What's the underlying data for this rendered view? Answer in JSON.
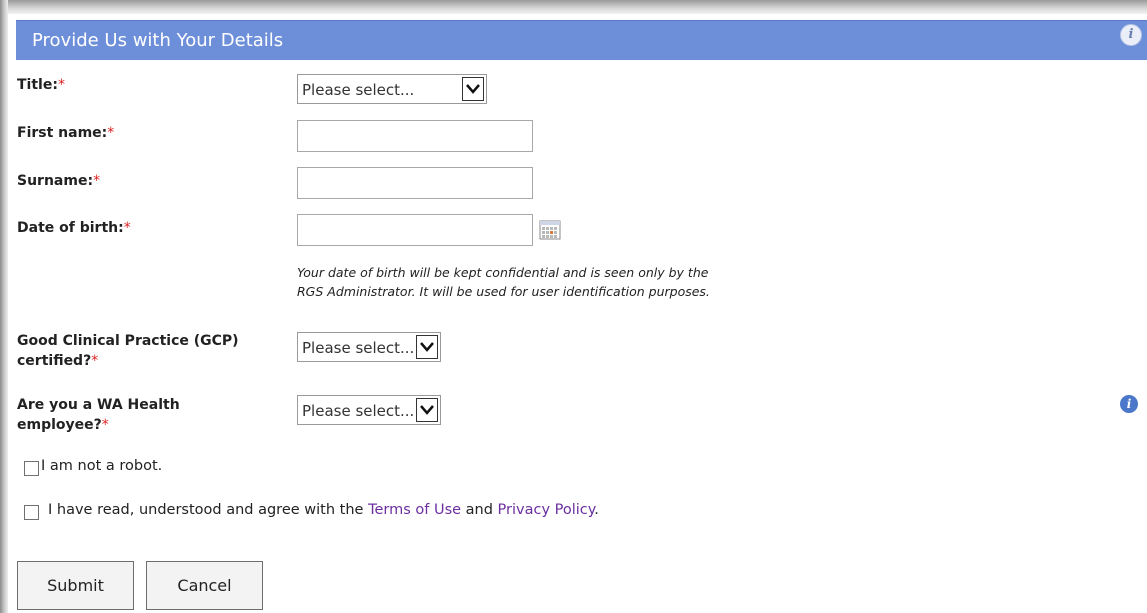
{
  "header": {
    "title": "Provide Us with Your Details",
    "info_icon": "i"
  },
  "form": {
    "title_label": "Title:",
    "title_select": "Please select...",
    "first_name_label": "First name:",
    "first_name_value": "",
    "surname_label": "Surname:",
    "surname_value": "",
    "dob_label": "Date of birth:",
    "dob_value": "",
    "dob_note_line1": "Your date of birth will be kept confidential and is seen only by the",
    "dob_note_line2": "RGS Administrator. It will be used for user identification purposes.",
    "gcp_label_line1": "Good Clinical Practice (GCP)",
    "gcp_label_line2": "certified?",
    "gcp_select": "Please select...",
    "wa_label_line1": "Are you a WA Health",
    "wa_label_line2": "employee?",
    "wa_select": "Please select...",
    "wa_info_icon": "i",
    "required_mark": "*",
    "robot_label": "I am not a robot.",
    "robot_checked": false,
    "terms_prefix": "I have read, understood and agree with the ",
    "terms_link": "Terms of Use",
    "terms_and": " and ",
    "privacy_link": "Privacy Policy",
    "terms_suffix": ".",
    "terms_checked": false
  },
  "buttons": {
    "submit": "Submit",
    "cancel": "Cancel"
  },
  "colors": {
    "header_bg": "#6d8fd9",
    "required": "#dd2222",
    "link": "#6b2fa0",
    "info_icon": "#4a77c9"
  },
  "icons": [
    "info-icon",
    "calendar-icon",
    "chevron-down-icon"
  ]
}
